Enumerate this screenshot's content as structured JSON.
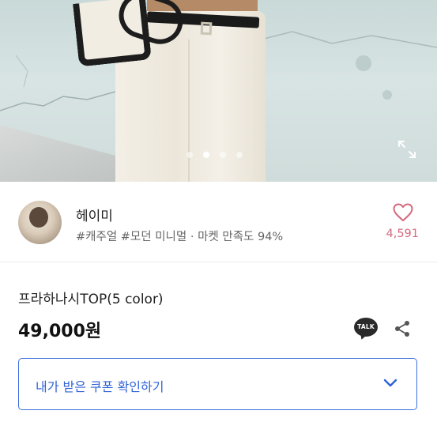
{
  "seller": {
    "name": "헤이미",
    "tags": "#캐주얼 #모던 미니멀 · 마켓 만족도 94%",
    "likes": "4,591"
  },
  "product": {
    "title": "프라하나시TOP(5 color)",
    "price": "49,000원"
  },
  "actions": {
    "talk_label": "TALK"
  },
  "coupon": {
    "label": "내가 받은 쿠폰 확인하기"
  },
  "carousel": {
    "total": 4,
    "active_index": 1
  },
  "colors": {
    "accent_blue": "#2f63d6",
    "like_pink": "#d46a7d"
  },
  "icons": [
    "expand-icon",
    "heart-icon",
    "kakao-talk-icon",
    "share-icon",
    "chevron-down-icon"
  ]
}
